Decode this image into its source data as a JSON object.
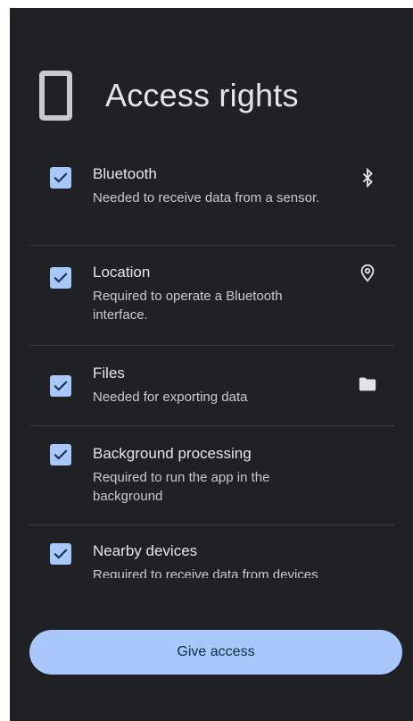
{
  "header": {
    "title": "Access rights",
    "icon": "phone-icon"
  },
  "permissions": [
    {
      "title": "Bluetooth",
      "description": "Needed to receive data from a sensor.",
      "checked": true,
      "icon": "bluetooth-icon"
    },
    {
      "title": "Location",
      "description": "Required to operate a Bluetooth interface.",
      "checked": true,
      "icon": "location-pin-icon"
    },
    {
      "title": "Files",
      "description": "Needed for exporting data",
      "checked": true,
      "icon": "folder-icon"
    },
    {
      "title": "Background processing",
      "description": "Required to run the app in the background",
      "checked": true,
      "icon": ""
    },
    {
      "title": "Nearby devices",
      "description": "Required to receive data from devices",
      "checked": true,
      "icon": ""
    }
  ],
  "action": {
    "label": "Give access"
  },
  "colors": {
    "background": "#202124",
    "accent": "#a8c7fa",
    "divider": "#3b3d40"
  }
}
